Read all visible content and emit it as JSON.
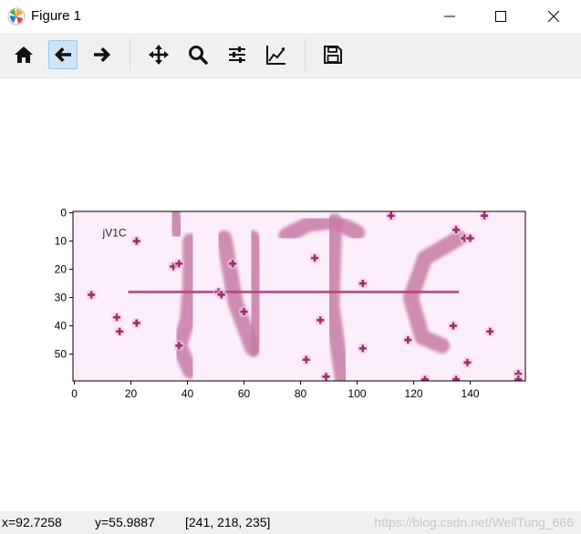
{
  "window": {
    "title": "Figure 1",
    "icon": "matplotlib-logo-icon",
    "controls": [
      "minimize-icon",
      "maximize-icon",
      "close-icon"
    ]
  },
  "toolbar": {
    "tools": [
      {
        "name": "home",
        "icon": "home-icon"
      },
      {
        "name": "back",
        "icon": "arrow-left-icon",
        "active": true
      },
      {
        "name": "forward",
        "icon": "arrow-right-icon"
      },
      {
        "name": "pan",
        "icon": "move-icon"
      },
      {
        "name": "zoom",
        "icon": "magnifier-icon"
      },
      {
        "name": "subplots",
        "icon": "sliders-icon"
      },
      {
        "name": "customize",
        "icon": "line-chart-icon"
      },
      {
        "name": "save",
        "icon": "floppy-disk-icon"
      }
    ]
  },
  "status": {
    "x": "x=92.7258",
    "y": "y=55.9887",
    "rgb": "[241, 218, 235]",
    "watermark": "https://blog.csdn.net/WellTung_666"
  },
  "chart_data": {
    "type": "image",
    "image_text": "jV1C",
    "image_size": [
      160,
      60
    ],
    "xlim": [
      -0.5,
      159.5
    ],
    "ylim": [
      59.5,
      -0.5
    ],
    "xticks": [
      0,
      20,
      40,
      60,
      80,
      100,
      120,
      140
    ],
    "yticks": [
      0,
      10,
      20,
      30,
      40,
      50
    ],
    "colors": {
      "background": "#fceefa",
      "stroke": "#c77ba6",
      "noise": "#9b2f6d",
      "line": "#b5487f",
      "text": "#222222"
    },
    "noise_dots": [
      [
        6,
        29
      ],
      [
        15,
        37
      ],
      [
        16,
        42
      ],
      [
        22,
        39
      ],
      [
        22,
        10
      ],
      [
        35,
        19
      ],
      [
        37,
        18
      ],
      [
        37,
        47
      ],
      [
        51,
        28
      ],
      [
        52,
        29
      ],
      [
        56,
        18
      ],
      [
        60,
        35
      ],
      [
        85,
        16
      ],
      [
        87,
        38
      ],
      [
        82,
        52
      ],
      [
        89,
        58
      ],
      [
        102,
        25
      ],
      [
        102,
        48
      ],
      [
        112,
        1
      ],
      [
        124,
        59
      ],
      [
        135,
        6
      ],
      [
        134,
        40
      ],
      [
        138,
        9
      ],
      [
        140,
        9
      ],
      [
        139,
        53
      ],
      [
        145,
        1
      ],
      [
        147,
        42
      ],
      [
        157,
        57
      ],
      [
        157,
        59
      ],
      [
        135,
        59
      ],
      [
        118,
        45
      ]
    ]
  }
}
